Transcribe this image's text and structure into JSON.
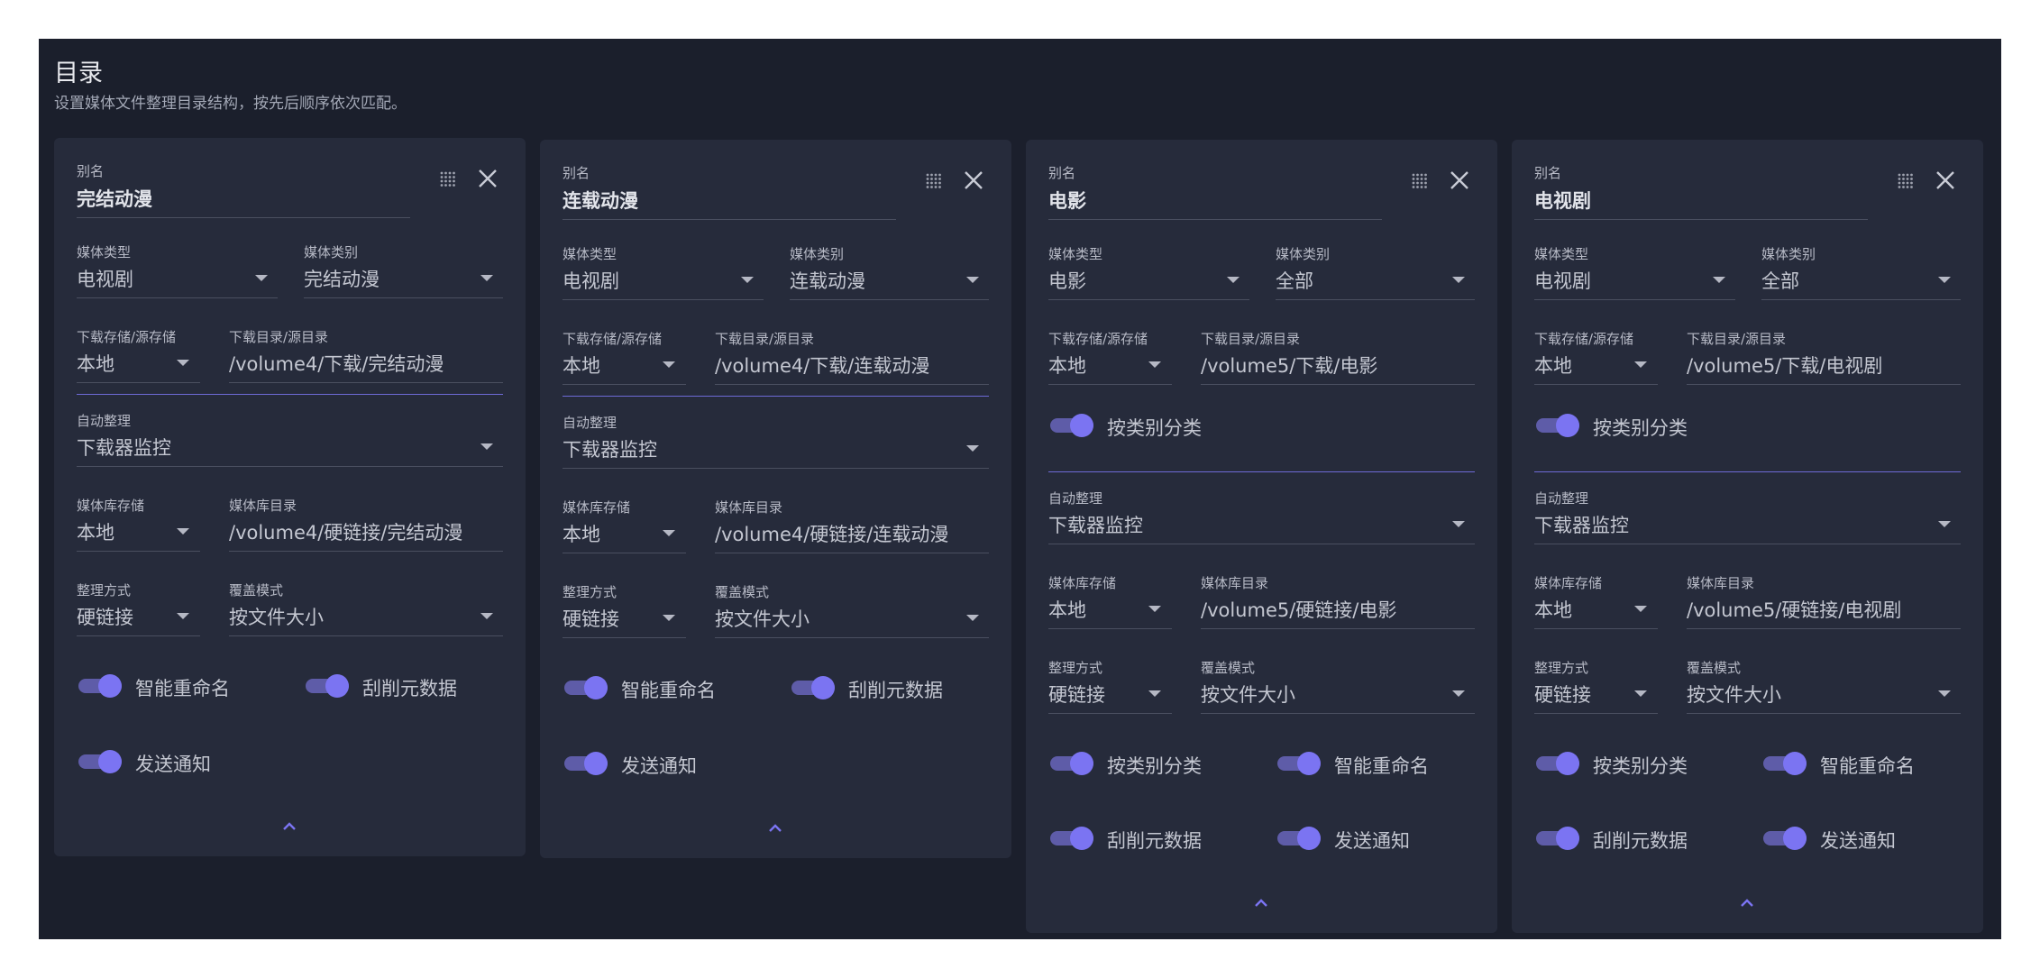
{
  "title": "目录",
  "subtitle": "设置媒体文件整理目录结构，按先后顺序依次匹配。",
  "labels": {
    "alias": "别名",
    "media_type": "媒体类型",
    "media_category": "媒体类别",
    "download_storage": "下载存储/源存储",
    "download_dir": "下载目录/源目录",
    "auto_organize": "自动整理",
    "library_storage": "媒体库存储",
    "library_dir": "媒体库目录",
    "organize_mode": "整理方式",
    "overwrite_mode": "覆盖模式"
  },
  "toggles": {
    "by_category": "按类别分类",
    "smart_rename": "智能重命名",
    "scrape": "刮削元数据",
    "notify": "发送通知"
  },
  "theme": {
    "accent": "#7b74f2",
    "card": "#262b3b",
    "panel": "#1b1f2c"
  },
  "cards": [
    {
      "alias": "完结动漫",
      "media_type": "电视剧",
      "media_category": "完结动漫",
      "download_storage": "本地",
      "download_dir": "/volume4/下载/完结动漫",
      "auto_organize": "下载器监控",
      "library_storage": "本地",
      "library_dir": "/volume4/硬链接/完结动漫",
      "organize_mode": "硬链接",
      "overwrite_mode": "按文件大小"
    },
    {
      "alias": "连载动漫",
      "media_type": "电视剧",
      "media_category": "连载动漫",
      "download_storage": "本地",
      "download_dir": "/volume4/下载/连载动漫",
      "auto_organize": "下载器监控",
      "library_storage": "本地",
      "library_dir": "/volume4/硬链接/连载动漫",
      "organize_mode": "硬链接",
      "overwrite_mode": "按文件大小"
    },
    {
      "alias": "电影",
      "media_type": "电影",
      "media_category": "全部",
      "download_storage": "本地",
      "download_dir": "/volume5/下载/电影",
      "auto_organize": "下载器监控",
      "library_storage": "本地",
      "library_dir": "/volume5/硬链接/电影",
      "organize_mode": "硬链接",
      "overwrite_mode": "按文件大小"
    },
    {
      "alias": "电视剧",
      "media_type": "电视剧",
      "media_category": "全部",
      "download_storage": "本地",
      "download_dir": "/volume5/下载/电视剧",
      "auto_organize": "下载器监控",
      "library_storage": "本地",
      "library_dir": "/volume5/硬链接/电视剧",
      "organize_mode": "硬链接",
      "overwrite_mode": "按文件大小"
    }
  ]
}
